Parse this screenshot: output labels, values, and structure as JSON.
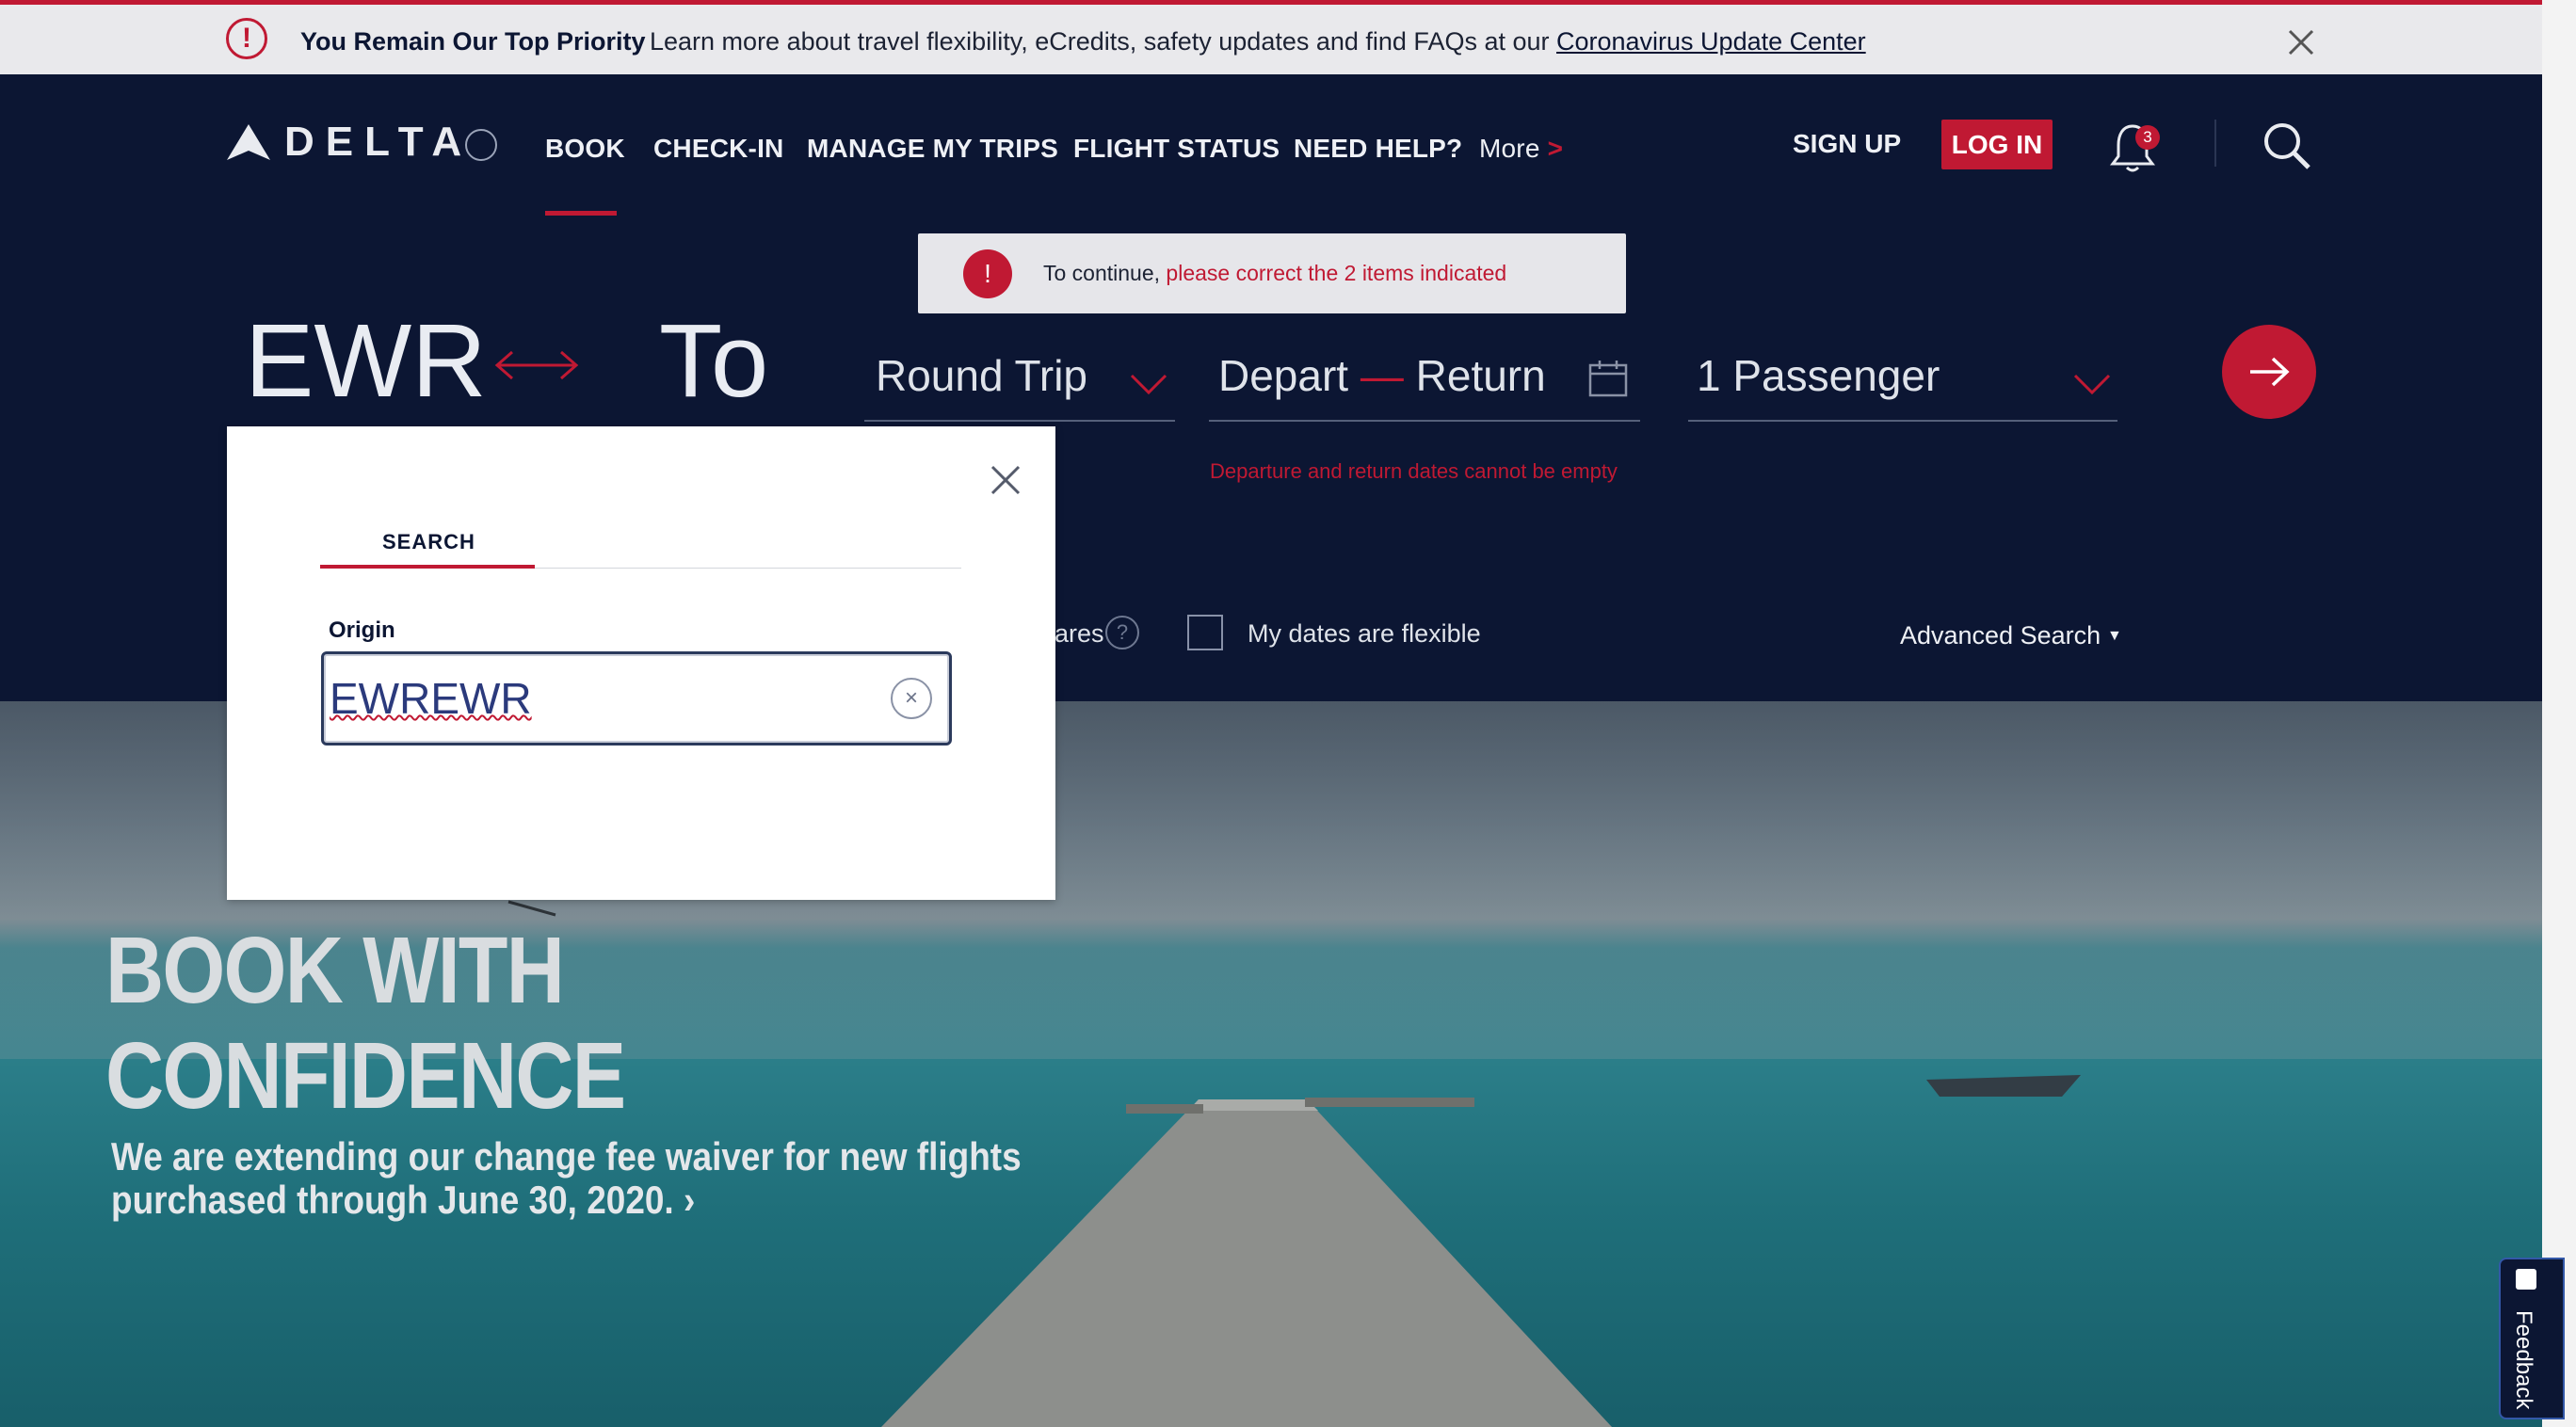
{
  "alert": {
    "title": "You Remain Our Top Priority",
    "message": "Learn more about travel flexibility, eCredits, safety updates and find FAQs at our ",
    "link": "Coronavirus Update Center",
    "icon": "exclamation-icon"
  },
  "nav": {
    "logo": "DELTA",
    "items": [
      "BOOK",
      "CHECK-IN",
      "MANAGE MY TRIPS",
      "FLIGHT STATUS",
      "NEED HELP?"
    ],
    "more": "More",
    "more_chevron": ">",
    "sign_up": "SIGN UP",
    "log_in": "LOG IN",
    "notifications_count": "3"
  },
  "error": {
    "icon_text": "!",
    "prefix": "To continue, ",
    "link": "please correct the 2 items indicated"
  },
  "booking": {
    "origin": "EWR",
    "destination": "To",
    "trip_type": "Round Trip",
    "depart": "Depart",
    "return": "Return",
    "passengers": "1 Passenger",
    "dates_error": "Departure and return dates cannot be empty",
    "fares_fragment": "ares",
    "help_icon_text": "?",
    "flexible_label": "My dates are flexible",
    "advanced_search": "Advanced Search"
  },
  "modal": {
    "tab": "SEARCH",
    "origin_label": "Origin",
    "origin_value": "EWREWR",
    "clear_text": "×"
  },
  "hero": {
    "title_line1": "BOOK WITH",
    "title_line2": "CONFIDENCE",
    "subtitle_line1": "We are extending our change fee waiver for new flights",
    "subtitle_line2": "purchased through June 30, 2020. ›"
  },
  "feedback": {
    "label": "Feedback"
  },
  "colors": {
    "brand_navy": "#0c1633",
    "brand_red": "#c01933"
  }
}
